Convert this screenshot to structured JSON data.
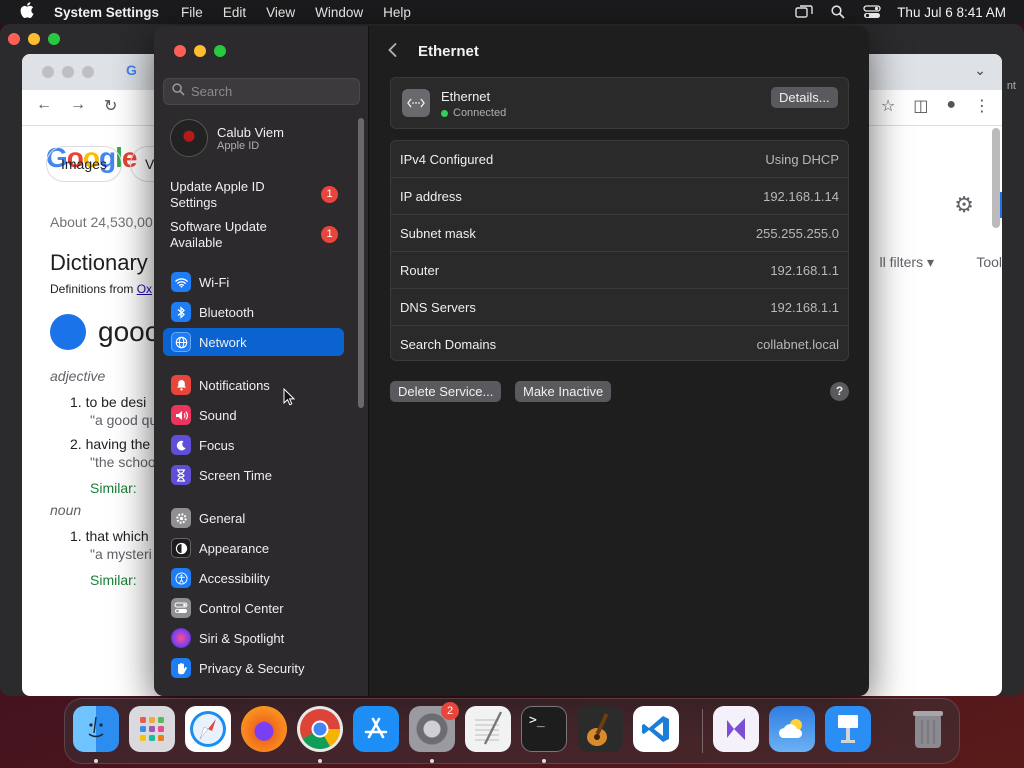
{
  "menubar": {
    "apple_icon": "apple-logo-icon",
    "app_name": "System Settings",
    "menus": [
      "File",
      "Edit",
      "View",
      "Window",
      "Help"
    ],
    "datetime": "Thu Jul 6  8:41 AM"
  },
  "browser": {
    "tab_logo": "G",
    "logo": [
      "G",
      "o",
      "o",
      "g",
      "l",
      "e"
    ],
    "chips": [
      "Images",
      "Vi"
    ],
    "result_count": "About 24,530,00",
    "dict_title": "Dictionary",
    "dict_sub_prefix": "Definitions from ",
    "dict_sub_link": "Ox",
    "word": "gooc",
    "pos_adjective": "adjective",
    "def1": "1.   to be desi",
    "ex1": "\"a good qu",
    "def2": "2.   having the",
    "ex2": "\"the schoo",
    "similar_label": "Similar:",
    "pos_noun": "noun",
    "def3": "1.   that which",
    "ex3": "\"a mysteri",
    "filters": "ll filters ▾",
    "tools": "Tool",
    "right_edge_text": "nt"
  },
  "sidebar": {
    "search_placeholder": "Search",
    "user": {
      "name": "Calub Viem",
      "sub": "Apple ID"
    },
    "notices": [
      {
        "label": "Update Apple ID Settings",
        "count": "1"
      },
      {
        "label": "Software Update Available",
        "count": "1"
      }
    ],
    "items": [
      {
        "label": "Wi-Fi",
        "icon": "wifi-icon",
        "color": "#1e7cf5"
      },
      {
        "label": "Bluetooth",
        "icon": "bluetooth-icon",
        "color": "#1e7cf5"
      },
      {
        "label": "Network",
        "icon": "globe-icon",
        "color": "#1e7cf5"
      },
      {
        "label": "Notifications",
        "icon": "bell-icon",
        "color": "#e8453c"
      },
      {
        "label": "Sound",
        "icon": "speaker-icon",
        "color": "#e8365d"
      },
      {
        "label": "Focus",
        "icon": "moon-icon",
        "color": "#5e4fd6"
      },
      {
        "label": "Screen Time",
        "icon": "hourglass-icon",
        "color": "#5e4fd6"
      },
      {
        "label": "General",
        "icon": "gear-icon",
        "color": "#8e8e93"
      },
      {
        "label": "Appearance",
        "icon": "appearance-icon",
        "color": "#1c1c1e"
      },
      {
        "label": "Accessibility",
        "icon": "accessibility-icon",
        "color": "#1e7cf5"
      },
      {
        "label": "Control Center",
        "icon": "control-center-icon",
        "color": "#8e8e93"
      },
      {
        "label": "Siri & Spotlight",
        "icon": "siri-icon",
        "color": "#b045c9"
      },
      {
        "label": "Privacy & Security",
        "icon": "hand-icon",
        "color": "#1e7cf5"
      }
    ]
  },
  "main": {
    "title": "Ethernet",
    "service": {
      "name": "Ethernet",
      "status": "Connected",
      "status_color": "#30d158"
    },
    "details_button": "Details...",
    "rows": [
      {
        "label": "IPv4 Configured",
        "value": "Using DHCP"
      },
      {
        "label": "IP address",
        "value": "192.168.1.14"
      },
      {
        "label": "Subnet mask",
        "value": "255.255.255.0"
      },
      {
        "label": "Router",
        "value": "192.168.1.1"
      },
      {
        "label": "DNS Servers",
        "value": "192.168.1.1"
      },
      {
        "label": "Search Domains",
        "value": "collabnet.local"
      }
    ],
    "delete_button": "Delete Service...",
    "inactive_button": "Make Inactive",
    "help": "?"
  },
  "dock": {
    "apps": [
      {
        "name": "finder",
        "icon": "finder-icon",
        "color": "#2d8cf0",
        "running": true
      },
      {
        "name": "launchpad",
        "icon": "launchpad-icon",
        "color": "#d9d9de",
        "running": false
      },
      {
        "name": "safari",
        "icon": "safari-icon",
        "color": "#1b8ef2",
        "running": false
      },
      {
        "name": "firefox",
        "icon": "firefox-icon",
        "color": "#f26b1d",
        "running": false
      },
      {
        "name": "chrome",
        "icon": "chrome-icon",
        "color": "#e9e9e9",
        "running": true
      },
      {
        "name": "app-store",
        "icon": "app-store-icon",
        "color": "#1c8ef5",
        "running": false
      },
      {
        "name": "system-settings",
        "icon": "system-settings-icon",
        "color": "#8a8a90",
        "running": true,
        "badge": "2"
      },
      {
        "name": "textedit",
        "icon": "textedit-icon",
        "color": "#f2f2f2",
        "running": false
      },
      {
        "name": "terminal",
        "icon": "terminal-icon",
        "color": "#1d1d1d",
        "running": true
      },
      {
        "name": "garageband",
        "icon": "garageband-icon",
        "color": "#2b2b2b",
        "running": false
      },
      {
        "name": "vscode",
        "icon": "vscode-icon",
        "color": "#ffffff",
        "running": false
      },
      {
        "name": "visual-studio",
        "icon": "visual-studio-icon",
        "color": "#f4f1fb",
        "running": false
      },
      {
        "name": "weather",
        "icon": "weather-icon",
        "color": "#2f7ee0",
        "running": false
      },
      {
        "name": "keynote",
        "icon": "keynote-icon",
        "color": "#2a8ef4",
        "running": false
      },
      {
        "name": "trash",
        "icon": "trash-icon",
        "color": "#6e6e73",
        "running": false
      }
    ]
  }
}
